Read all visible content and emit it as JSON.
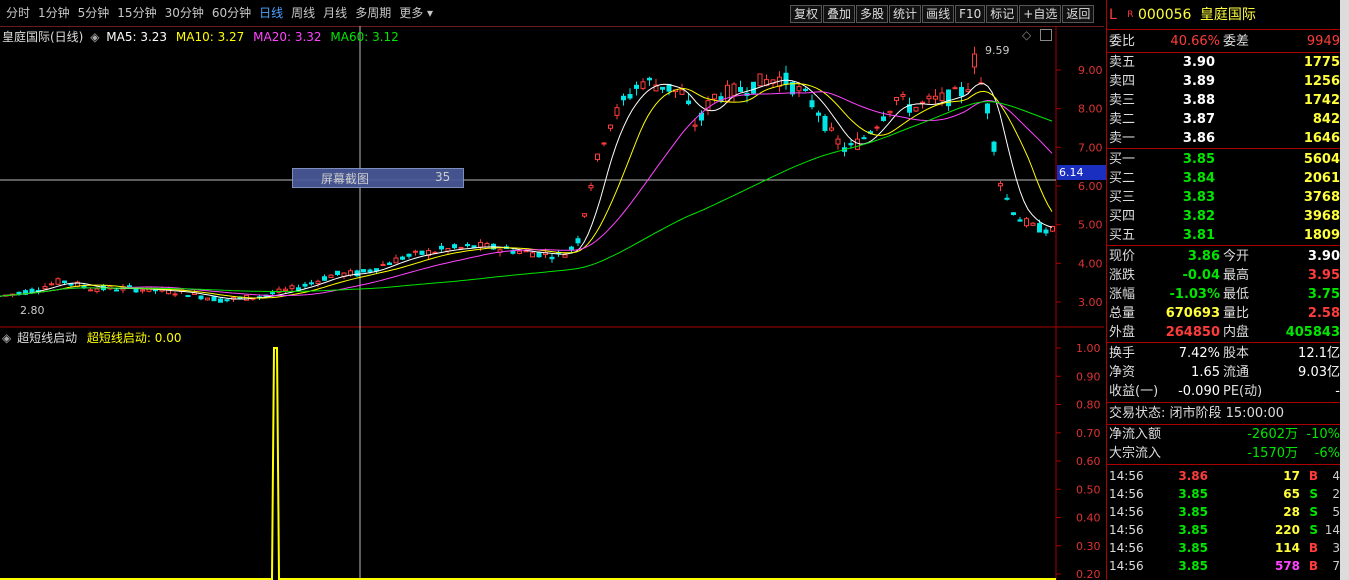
{
  "toolbar": {
    "periods": [
      "分时",
      "1分钟",
      "5分钟",
      "15分钟",
      "30分钟",
      "60分钟",
      "日线",
      "周线",
      "月线",
      "多周期",
      "更多"
    ],
    "active_period": "日线",
    "buttons": [
      "复权",
      "叠加",
      "多股",
      "统计",
      "画线",
      "F10",
      "标记",
      "+自选",
      "返回"
    ]
  },
  "main_legend": {
    "title": "皇庭国际(日线)",
    "ma5": "MA5: 3.23",
    "ma10": "MA10: 3.27",
    "ma20": "MA20: 3.32",
    "ma60": "MA60: 3.12",
    "high_label": "9.59",
    "low_label": "2.80",
    "price_marker": "6.14"
  },
  "screenshot_tip": {
    "label": "屏幕截图",
    "value": "35"
  },
  "indicator": {
    "title": "超短线启动",
    "value_label": "超短线启动: 0.00"
  },
  "quote": {
    "market_flag": "L",
    "r_flag": "R",
    "code": "000056",
    "name": "皇庭国际",
    "weibi_label": "委比",
    "weibi": "40.66%",
    "weicha_label": "委差",
    "weicha": "9949",
    "asks": [
      {
        "label": "卖五",
        "price": "3.90",
        "vol": "1775"
      },
      {
        "label": "卖四",
        "price": "3.89",
        "vol": "1256"
      },
      {
        "label": "卖三",
        "price": "3.88",
        "vol": "1742"
      },
      {
        "label": "卖二",
        "price": "3.87",
        "vol": "842"
      },
      {
        "label": "卖一",
        "price": "3.86",
        "vol": "1646"
      }
    ],
    "bids": [
      {
        "label": "买一",
        "price": "3.85",
        "vol": "5604"
      },
      {
        "label": "买二",
        "price": "3.84",
        "vol": "2061"
      },
      {
        "label": "买三",
        "price": "3.83",
        "vol": "3768"
      },
      {
        "label": "买四",
        "price": "3.82",
        "vol": "3968"
      },
      {
        "label": "买五",
        "price": "3.81",
        "vol": "1809"
      }
    ],
    "stats": [
      {
        "l1": "现价",
        "v1": "3.86",
        "c1": "green",
        "l2": "今开",
        "v2": "3.90",
        "c2": "white"
      },
      {
        "l1": "涨跌",
        "v1": "-0.04",
        "c1": "green",
        "l2": "最高",
        "v2": "3.95",
        "c2": "red"
      },
      {
        "l1": "涨幅",
        "v1": "-1.03%",
        "c1": "green",
        "l2": "最低",
        "v2": "3.75",
        "c2": "green"
      },
      {
        "l1": "总量",
        "v1": "670693",
        "c1": "yellow",
        "l2": "量比",
        "v2": "2.58",
        "c2": "red"
      },
      {
        "l1": "外盘",
        "v1": "264850",
        "c1": "red",
        "l2": "内盘",
        "v2": "405843",
        "c2": "green"
      }
    ],
    "stats2": [
      {
        "l1": "换手",
        "v1": "7.42%",
        "l2": "股本",
        "v2": "12.1亿"
      },
      {
        "l1": "净资",
        "v1": "1.65",
        "l2": "流通",
        "v2": "9.03亿"
      },
      {
        "l1": "收益(一)",
        "v1": "-0.090",
        "l2": "PE(动)",
        "v2": "-"
      }
    ],
    "trade_status": "交易状态: 闭市阶段 15:00:00",
    "flows": [
      {
        "label": "净流入额",
        "value": "-2602万",
        "pct": "-10%"
      },
      {
        "label": "大宗流入",
        "value": "-1570万",
        "pct": "-6%"
      }
    ],
    "ticks": [
      {
        "time": "14:56",
        "price": "3.86",
        "vol": "17",
        "side": "B",
        "n": "4"
      },
      {
        "time": "14:56",
        "price": "3.85",
        "vol": "65",
        "side": "S",
        "n": "2"
      },
      {
        "time": "14:56",
        "price": "3.85",
        "vol": "28",
        "side": "S",
        "n": "5"
      },
      {
        "time": "14:56",
        "price": "3.85",
        "vol": "220",
        "side": "S",
        "n": "14"
      },
      {
        "time": "14:56",
        "price": "3.85",
        "vol": "114",
        "side": "B",
        "n": "3"
      },
      {
        "time": "14:56",
        "price": "3.85",
        "vol": "578",
        "side": "B",
        "n": "7"
      }
    ]
  },
  "price_axis": [
    "9.00",
    "8.00",
    "7.00",
    "6.00",
    "5.00",
    "4.00",
    "3.00"
  ],
  "indicator_axis": [
    "1.00",
    "0.90",
    "0.80",
    "0.70",
    "0.60",
    "0.50",
    "0.40",
    "0.30",
    "0.20"
  ],
  "colors": {
    "up": "#ff3c3c",
    "down": "#00e6e6",
    "ma5": "#ffffff",
    "ma10": "#ffff00",
    "ma20": "#ff44ff",
    "ma60": "#00e600",
    "indicator": "#ffff00"
  }
}
